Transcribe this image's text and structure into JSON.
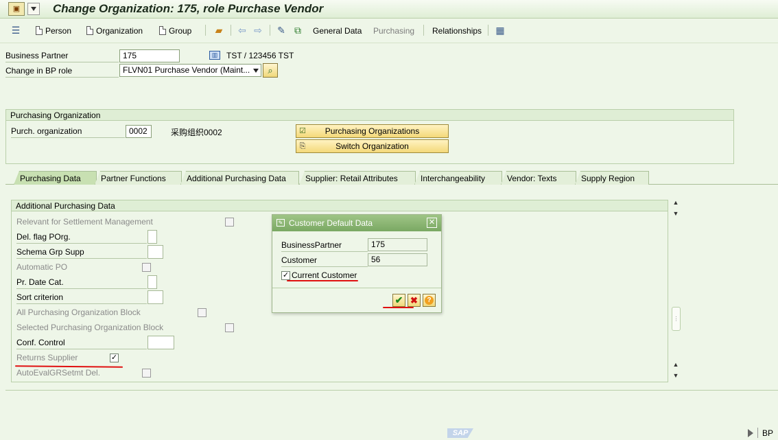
{
  "title": "Change Organization: 175, role Purchase Vendor",
  "toolbar": {
    "person": "Person",
    "organization": "Organization",
    "group": "Group",
    "general_data": "General Data",
    "purchasing": "Purchasing",
    "relationships": "Relationships"
  },
  "header": {
    "bp_label": "Business Partner",
    "bp_value": "175",
    "bp_desc": "TST / 123456 TST",
    "role_label": "Change in BP role",
    "role_value": "FLVN01 Purchase Vendor (Maint..."
  },
  "porg": {
    "title": "Purchasing Organization",
    "label": "Purch. organization",
    "value": "0002",
    "desc": "采购组织0002",
    "btn_orgs": "Purchasing Organizations",
    "btn_switch": "Switch Organization"
  },
  "tabs": [
    "Purchasing Data",
    "Partner Functions",
    "Additional Purchasing Data",
    "Supplier: Retail Attributes",
    "Interchangeability",
    "Vendor: Texts",
    "Supply Region"
  ],
  "additional": {
    "title": "Additional Purchasing Data",
    "fields": [
      {
        "label": "Relevant for Settlement Management",
        "checked": false
      },
      {
        "label": "Del. flag POrg."
      },
      {
        "label": "Schema Grp Supp"
      },
      {
        "label": "Automatic PO",
        "checked": false
      },
      {
        "label": "Pr. Date Cat."
      },
      {
        "label": "Sort criterion"
      },
      {
        "label": "All Purchasing Organization Block",
        "checked": false
      },
      {
        "label": "Selected Purchasing Organization Block",
        "checked": false
      },
      {
        "label": "Conf. Control"
      },
      {
        "label": "Returns Supplier",
        "checked": true
      },
      {
        "label": "AutoEvalGRSetmt Del.",
        "checked": false
      }
    ]
  },
  "dialog": {
    "title": "Customer Default Data",
    "bp_label": "BusinessPartner",
    "bp_value": "175",
    "customer_label": "Customer",
    "customer_value": "56",
    "current_customer_label": "Current Customer",
    "current_customer_checked": true
  },
  "status": {
    "logo": "SAP",
    "right": "BP"
  },
  "colors": {
    "accent_red": "#e01010",
    "background": "#eef6e8"
  }
}
